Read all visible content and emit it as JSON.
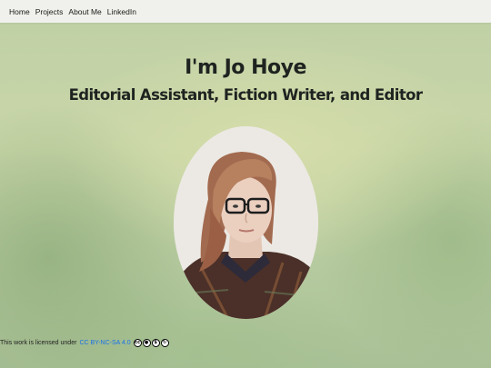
{
  "nav": {
    "items": [
      {
        "label": "Home"
      },
      {
        "label": "Projects"
      },
      {
        "label": "About Me"
      },
      {
        "label": "LinkedIn"
      }
    ]
  },
  "hero": {
    "title": "I'm Jo Hoye",
    "subtitle": "Editorial Assistant, Fiction Writer, and Editor"
  },
  "footer": {
    "license_text": "This work is licensed under",
    "license_link": "CC BY-NC-SA 4.0",
    "icons": [
      {
        "name": "cc-icon",
        "glyph": "cc"
      },
      {
        "name": "cc-by-icon",
        "glyph": "●"
      },
      {
        "name": "cc-nc-icon",
        "glyph": "$"
      },
      {
        "name": "cc-sa-icon",
        "glyph": "↻"
      }
    ]
  }
}
